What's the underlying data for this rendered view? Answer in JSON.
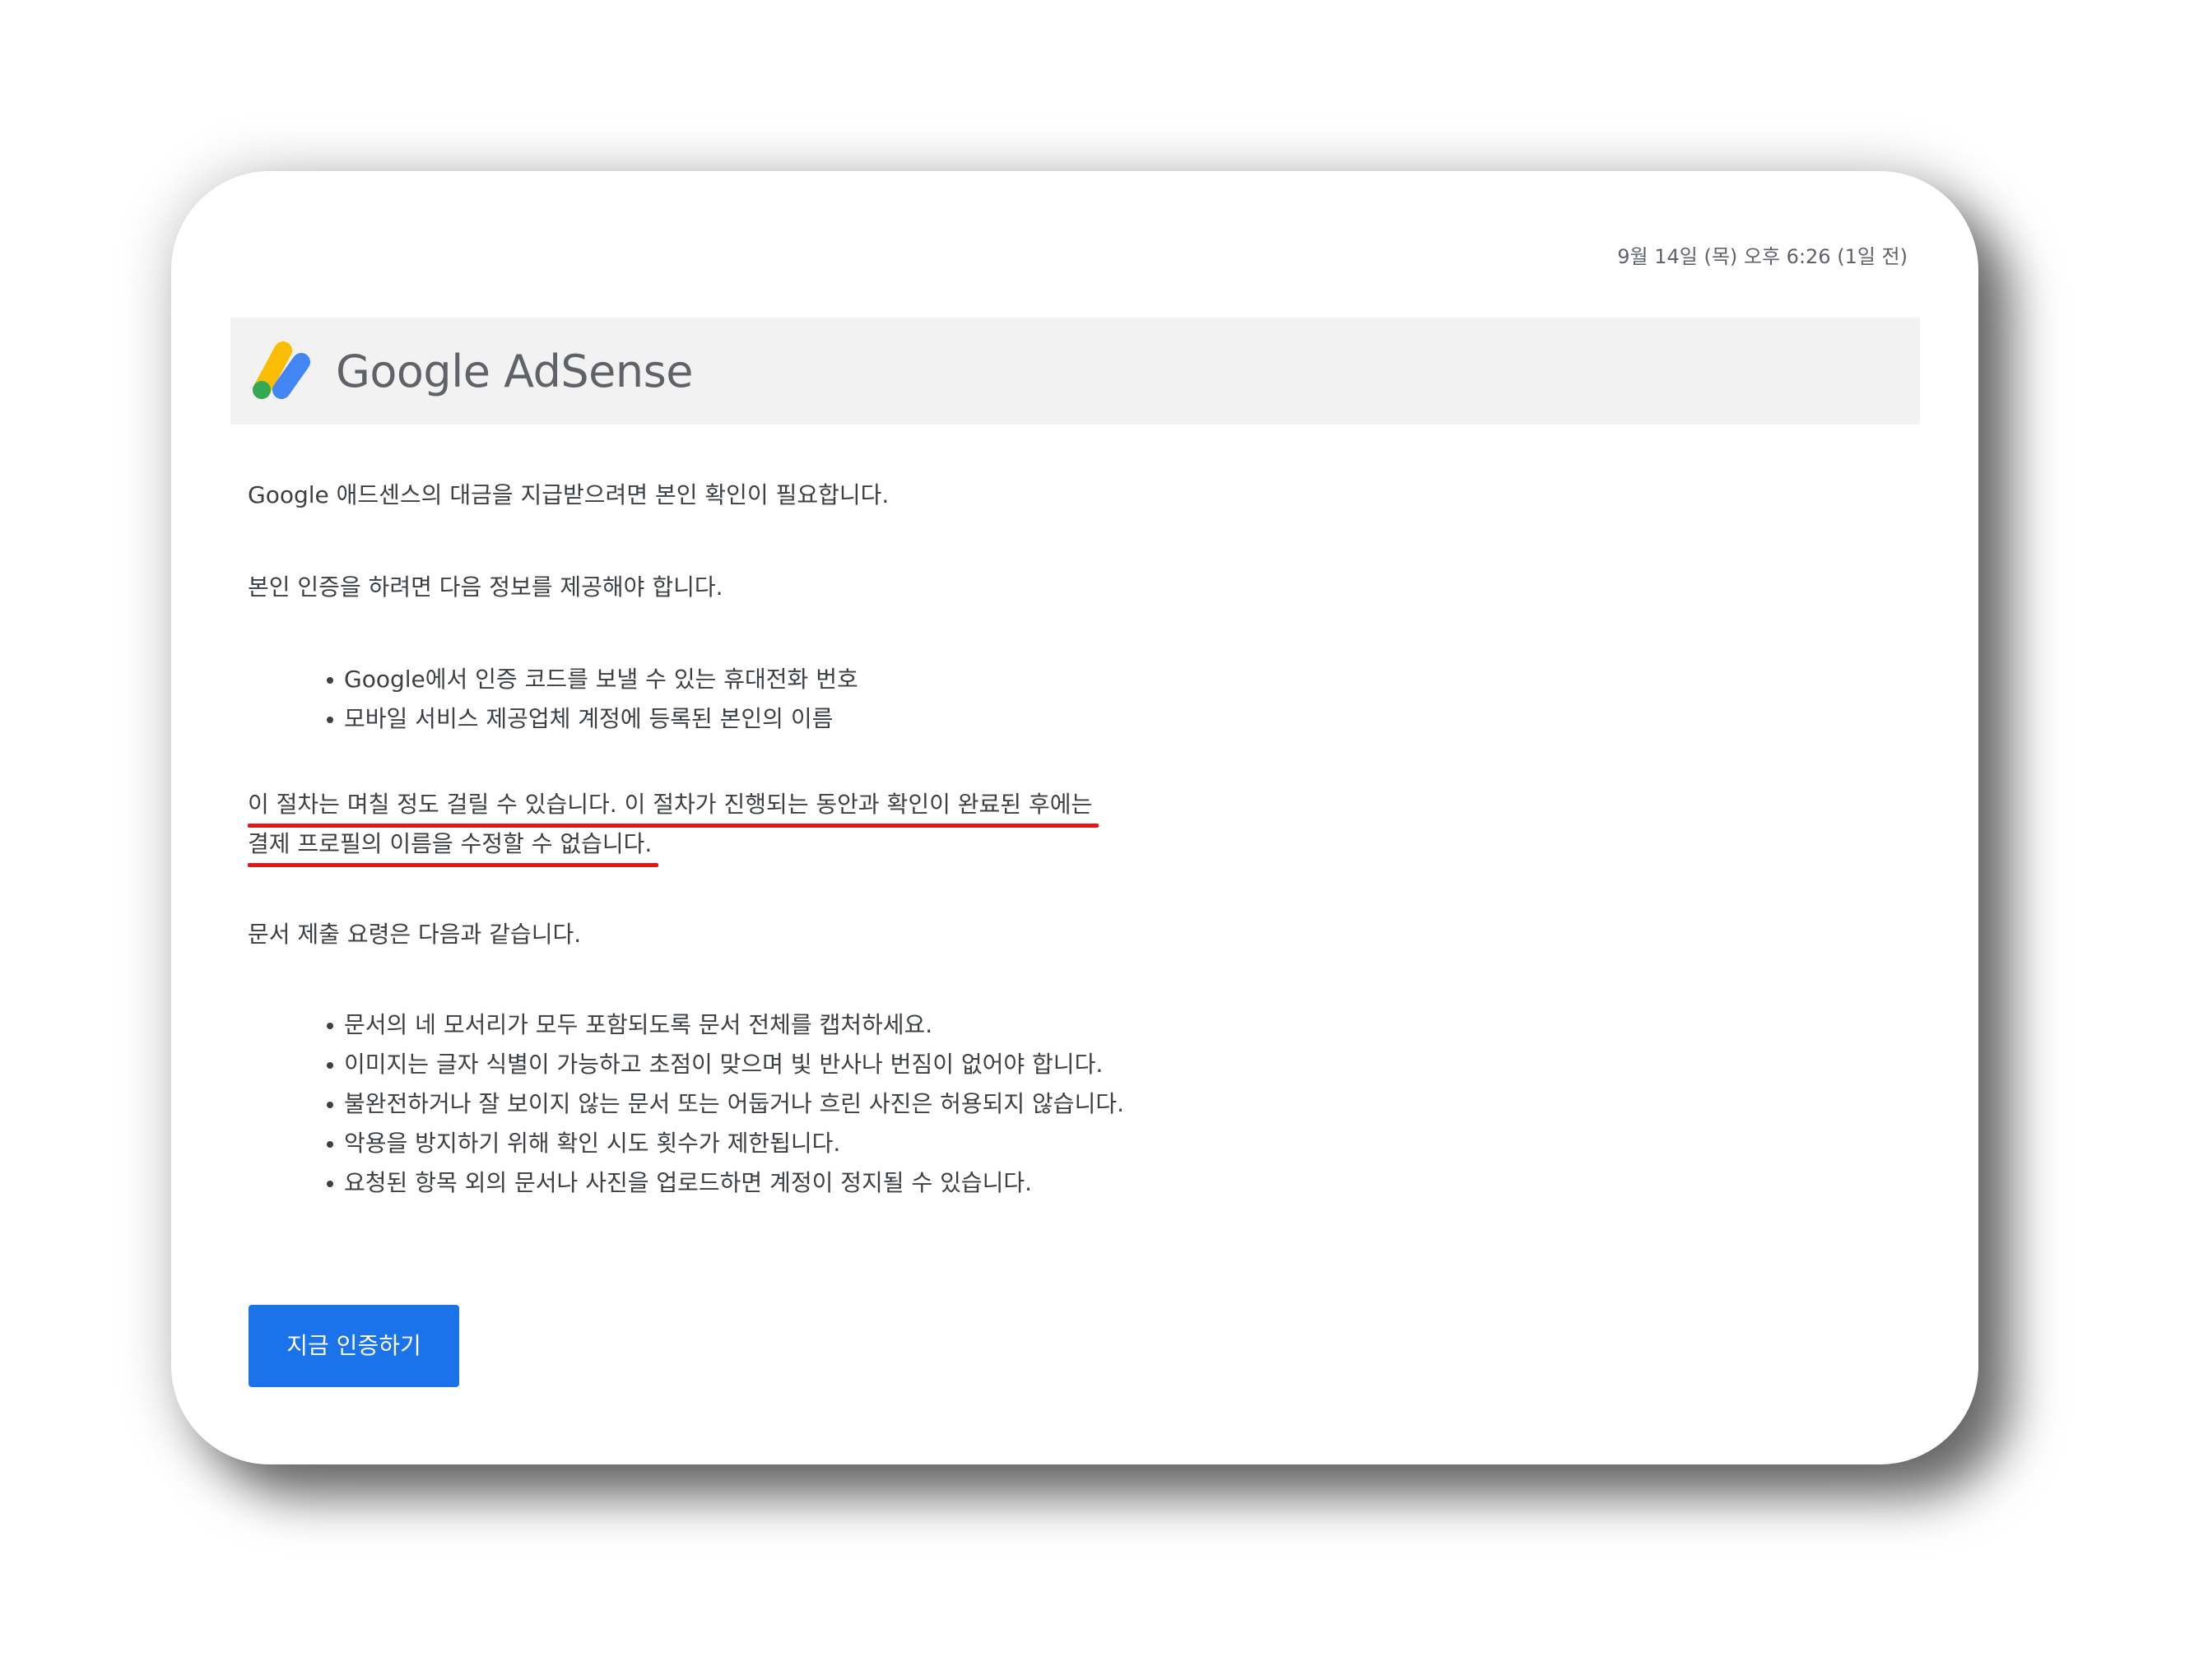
{
  "email": {
    "timestamp": "9월 14일 (목) 오후 6:26 (1일 전)",
    "brand": {
      "logo_text": "Google AdSense",
      "colors": {
        "yellow": "#fbbc04",
        "blue": "#4285f4",
        "green": "#34a853",
        "text": "#5f6368"
      }
    },
    "body": {
      "intro": "Google 애드센스의 대금을 지급받으려면 본인 확인이 필요합니다.",
      "requirements_title": "본인 인증을 하려면 다음 정보를 제공해야 합니다.",
      "requirements": [
        "Google에서 인증 코드를 보낼 수 있는 휴대전화 번호",
        "모바일 서비스 제공업체 계정에 등록된 본인의 이름"
      ],
      "warning_lines": [
        "이 절차는 며칠 정도 걸릴 수 있습니다. 이 절차가 진행되는 동안과 확인이 완료된 후에는",
        "결제 프로필의 이름을 수정할 수 없습니다."
      ],
      "docs_title": "문서 제출 요령은 다음과 같습니다.",
      "docs_rules": [
        "문서의 네 모서리가 모두 포함되도록 문서 전체를 캡처하세요.",
        "이미지는 글자 식별이 가능하고 초점이 맞으며 빛 반사나 번짐이 없어야 합니다.",
        "불완전하거나 잘 보이지 않는 문서 또는 어둡거나 흐린 사진은 허용되지 않습니다.",
        "악용을 방지하기 위해 확인 시도 횟수가 제한됩니다.",
        "요청된 항목 외의 문서나 사진을 업로드하면 계정이 정지될 수 있습니다."
      ]
    },
    "cta": {
      "label": "지금 인증하기",
      "color": "#1a73e8"
    },
    "highlight_color": "#e8121a"
  }
}
